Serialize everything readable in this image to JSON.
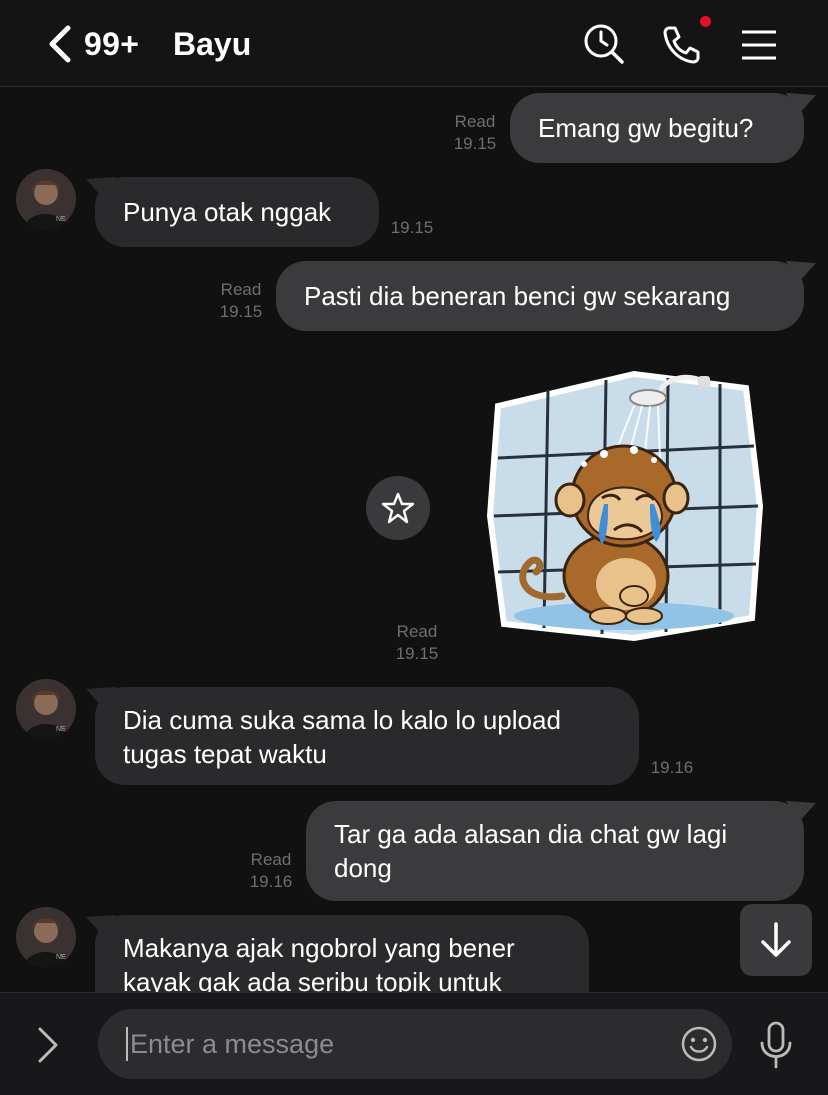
{
  "header": {
    "unread_count": "99+",
    "contact_name": "Bayu",
    "icons": [
      "back-chevron-icon",
      "search-clock-icon",
      "call-icon",
      "menu-icon"
    ]
  },
  "messages": [
    {
      "direction": "out",
      "text": "Emang gw begitu?",
      "status": "Read",
      "time": "19.15"
    },
    {
      "direction": "in",
      "text": "Punya otak nggak",
      "time": "19.15"
    },
    {
      "direction": "out",
      "text": "Pasti dia beneran benci gw sekarang",
      "status": "Read",
      "time": "19.15"
    },
    {
      "direction": "out",
      "type": "sticker",
      "sticker": "crying-monkey-in-shower",
      "status": "Read",
      "time": "19.15"
    },
    {
      "direction": "in",
      "lines": [
        "Dia cuma suka sama lo kalo lo upload",
        "tugas tepat waktu"
      ],
      "time": "19.16"
    },
    {
      "direction": "out",
      "lines": [
        "Tar ga ada alasan dia chat gw lagi",
        "dong"
      ],
      "status": "Read",
      "time": "19.16"
    },
    {
      "direction": "in",
      "lines": [
        "Makanya ajak ngobrol yang bener",
        "kayak gak ada seribu topik untuk"
      ]
    }
  ],
  "input": {
    "placeholder": "Enter a message"
  },
  "colors": {
    "background": "#111112",
    "outgoing_bubble": "#3b3b3d",
    "incoming_bubble": "#2a2a2c",
    "notification_dot": "#e0102a"
  }
}
